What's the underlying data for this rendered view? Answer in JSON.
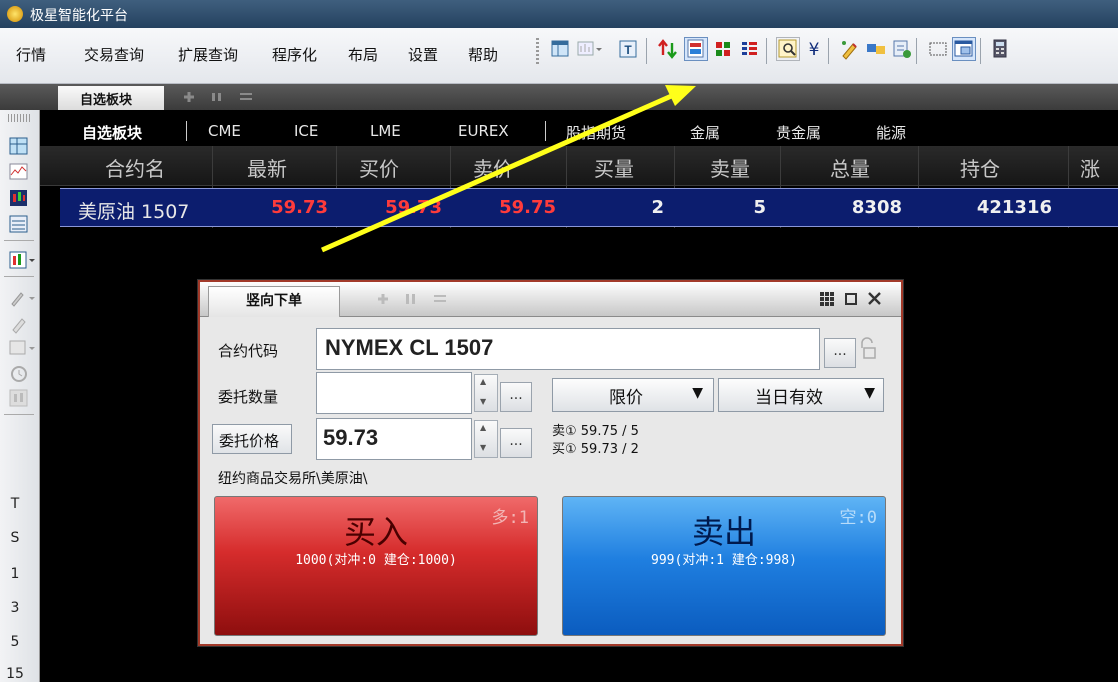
{
  "window": {
    "title": "极星智能化平台"
  },
  "menu": [
    "行情",
    "交易查询",
    "扩展查询",
    "程序化",
    "布局",
    "设置",
    "帮助"
  ],
  "toolbar_icons": [
    "table-icon",
    "chart-dropdown-icon",
    "text-icon",
    "arrows-icon",
    "vertical-order-icon",
    "grid-red-icon",
    "list-red-icon",
    "search-chart-icon",
    "yen-icon",
    "pen-tool-icon",
    "swap-icon",
    "export-icon",
    "frame-icon",
    "window-icon",
    "calculator-icon"
  ],
  "watchlist": {
    "tab_label": "自选板块"
  },
  "categories": [
    "自选板块",
    "CME",
    "ICE",
    "LME",
    "EUREX",
    "股指期货",
    "金属",
    "贵金属",
    "能源"
  ],
  "table": {
    "headers": [
      "合约名",
      "最新",
      "买价",
      "卖价",
      "买量",
      "卖量",
      "总量",
      "持仓",
      "涨"
    ],
    "row": {
      "name": "美原油 1507",
      "last": "59.73",
      "bid": "59.73",
      "ask": "59.75",
      "bid_qty": "2",
      "ask_qty": "5",
      "volume": "8308",
      "open_interest": "421316"
    }
  },
  "left_toolbar": {
    "labels": [
      "T",
      "S",
      "1",
      "3",
      "5",
      "15"
    ]
  },
  "order": {
    "title": "竖向下单",
    "contract_label": "合约代码",
    "contract_value": "NYMEX CL 1507",
    "qty_label": "委托数量",
    "qty_value": "",
    "price_label": "委托价格",
    "price_value": "59.73",
    "dots": "...",
    "order_type": "限价",
    "validity": "当日有效",
    "ask_quote": "卖① 59.75   / 5",
    "bid_quote": "买① 59.73   / 2",
    "exchange_path": "纽约商品交易所\\美原油\\",
    "buy": {
      "label": "买入",
      "count": "多:1",
      "detail": "1000(对冲:0 建仓:1000)"
    },
    "sell": {
      "label": "卖出",
      "count": "空:0",
      "detail": "999(对冲:1 建仓:998)"
    }
  },
  "colors": {
    "price_red": "#ff3b3b",
    "arrow": "#ffff1a",
    "row_bg": "#0c1d6e"
  }
}
